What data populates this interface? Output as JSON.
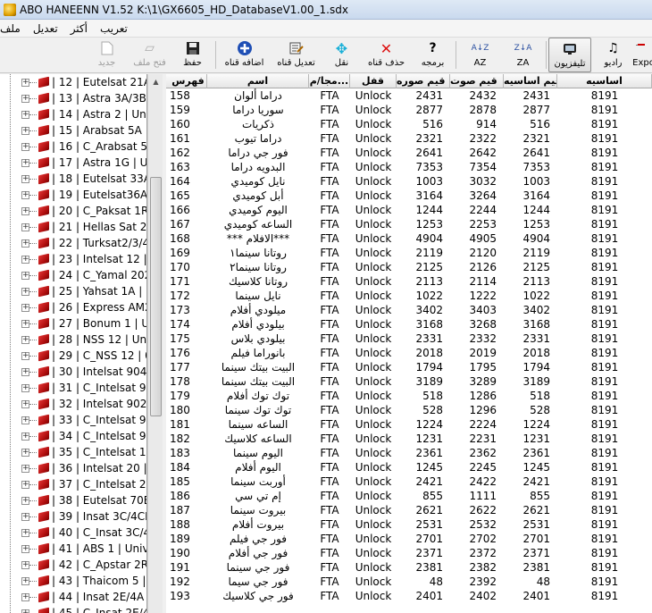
{
  "window": {
    "title": "ABO HANEENN     V1.52 K:\\1\\GX6605_HD_DatabaseV1.00_1.sdx"
  },
  "menu": [
    "تعريب",
    "أكثر",
    "تعديل",
    "ملف"
  ],
  "toolbar": [
    {
      "label": "Expo",
      "icon": "export-icon",
      "disabled": false,
      "selected": false
    },
    {
      "label": "راديو",
      "icon": "music-note-icon",
      "disabled": false,
      "selected": false
    },
    {
      "label": "تليفزيون",
      "icon": "tv-icon",
      "disabled": false,
      "selected": true
    },
    {
      "label": "ZA",
      "icon": "sort-za-icon",
      "disabled": false,
      "selected": false
    },
    {
      "label": "AZ",
      "icon": "sort-az-icon",
      "disabled": false,
      "selected": false
    },
    {
      "label": "برمجه",
      "icon": "help-icon",
      "disabled": false,
      "selected": false
    },
    {
      "label": "حذف قناه",
      "icon": "delete-icon",
      "disabled": false,
      "selected": false
    },
    {
      "label": "نقل",
      "icon": "move-icon",
      "disabled": false,
      "selected": false
    },
    {
      "label": "تعديل قناه",
      "icon": "edit-icon",
      "disabled": false,
      "selected": false
    },
    {
      "label": "اضافه قناه",
      "icon": "add-icon",
      "disabled": false,
      "selected": false
    },
    {
      "label": "حفظ",
      "icon": "save-icon",
      "disabled": false,
      "selected": false
    },
    {
      "label": "فتح ملف",
      "icon": "open-folder-icon",
      "disabled": true,
      "selected": false
    },
    {
      "label": "جديد",
      "icon": "new-file-icon",
      "disabled": true,
      "selected": false
    }
  ],
  "satellites": [
    "| 12 | Eutelsat 21A  |",
    "| 13 | Astra 3A/3B | U",
    "| 14 | Astra 2 | Univer",
    "| 15 | Arabsat 5A  | U",
    "| 16 | C_Arabsat 5A",
    "| 17 | Astra 1G  | Univ",
    "| 18 | Eutelsat 33A  |",
    "| 19 | Eutelsat36A/B",
    "| 20 | C_Paksat 1R  | (",
    "| 21 | Hellas Sat 2  | U",
    "| 22 | Turksat2/3/4A",
    "| 23 | Intelsat 12  | Ur",
    "| 24 | C_Yamal 202  |",
    "| 25 | Yahsat 1A  | Ur",
    "| 26 | Express AM22",
    "| 27 | Bonum 1 | Univ",
    "| 28 | NSS 12  | Unive",
    "| 29 | C_NSS 12  | 051",
    "| 30 | Intelsat 904  | U",
    "| 31 | C_Intelsat 904",
    "| 32 | Intelsat 902  | U",
    "| 33 | C_Intelsat 902",
    "| 34 | C_Intelsat 906",
    "| 35 | C_Intelsat 17  |",
    "| 36 | Intelsat 20 | Ur",
    "| 37 | C_Intelsat 20 |",
    "| 38 | Eutelsat 70B  | (",
    "| 39 | Insat 3C/4CR |",
    "| 40 | C_Insat 3C/4CF",
    "| 41 | ABS 1 | Univer",
    "| 42 | C_Apstar 2R  | (",
    "| 43 | Thaicom 5  | U",
    "| 44 | Insat 2E/4A  | U",
    "| 45 | C_Insat 2E/4A |"
  ],
  "grid": {
    "headers": {
      "idx": "فهرس",
      "name": "اسم",
      "fta": "مجا/م...",
      "lock": "قفل",
      "vpid": "قيم صوره",
      "apid": "قيم صوت",
      "sid": "قيم اساسيه",
      "base": "اساسيه"
    },
    "rows": [
      [
        "158",
        "دراما ألوان",
        "FTA",
        "Unlock",
        "2431",
        "2432",
        "2431",
        "8191"
      ],
      [
        "159",
        "سوريا دراما",
        "FTA",
        "Unlock",
        "2877",
        "2878",
        "2877",
        "8191"
      ],
      [
        "160",
        "ذكريات",
        "FTA",
        "Unlock",
        "516",
        "914",
        "516",
        "8191"
      ],
      [
        "161",
        "دراما تيوب",
        "FTA",
        "Unlock",
        "2321",
        "2322",
        "2321",
        "8191"
      ],
      [
        "162",
        "فور جي دراما",
        "FTA",
        "Unlock",
        "2641",
        "2642",
        "2641",
        "8191"
      ],
      [
        "163",
        "البدويه دراما",
        "FTA",
        "Unlock",
        "7353",
        "7354",
        "7353",
        "8191"
      ],
      [
        "164",
        "نايل كوميدي",
        "FTA",
        "Unlock",
        "1003",
        "3032",
        "1003",
        "8191"
      ],
      [
        "165",
        "أبل كوميدي",
        "FTA",
        "Unlock",
        "3164",
        "3264",
        "3164",
        "8191"
      ],
      [
        "166",
        "اليوم كوميدي",
        "FTA",
        "Unlock",
        "1244",
        "2244",
        "1244",
        "8191"
      ],
      [
        "167",
        "الساعه كوميدي",
        "FTA",
        "Unlock",
        "1253",
        "2253",
        "1253",
        "8191"
      ],
      [
        "168",
        "***الافلام ***",
        "FTA",
        "Unlock",
        "4904",
        "4905",
        "4904",
        "8191"
      ],
      [
        "169",
        "روتانا سينما١",
        "FTA",
        "Unlock",
        "2119",
        "2120",
        "2119",
        "8191"
      ],
      [
        "170",
        "روتانا سينما٢",
        "FTA",
        "Unlock",
        "2125",
        "2126",
        "2125",
        "8191"
      ],
      [
        "171",
        "روتانا كلاسيك",
        "FTA",
        "Unlock",
        "2113",
        "2114",
        "2113",
        "8191"
      ],
      [
        "172",
        "نايل سينما",
        "FTA",
        "Unlock",
        "1022",
        "1222",
        "1022",
        "8191"
      ],
      [
        "173",
        "ميلودي أفلام",
        "FTA",
        "Unlock",
        "3402",
        "3403",
        "3402",
        "8191"
      ],
      [
        "174",
        "بيلودي أفلام",
        "FTA",
        "Unlock",
        "3168",
        "3268",
        "3168",
        "8191"
      ],
      [
        "175",
        "بيلودي بلاس",
        "FTA",
        "Unlock",
        "2331",
        "2332",
        "2331",
        "8191"
      ],
      [
        "176",
        "بانوراما فيلم",
        "FTA",
        "Unlock",
        "2018",
        "2019",
        "2018",
        "8191"
      ],
      [
        "177",
        "البيت بيتك سينما",
        "FTA",
        "Unlock",
        "1794",
        "1795",
        "1794",
        "8191"
      ],
      [
        "178",
        "البيت بيتك سينما",
        "FTA",
        "Unlock",
        "3189",
        "3289",
        "3189",
        "8191"
      ],
      [
        "179",
        "توك توك أفلام",
        "FTA",
        "Unlock",
        "518",
        "1286",
        "518",
        "8191"
      ],
      [
        "180",
        "توك توك سينما",
        "FTA",
        "Unlock",
        "528",
        "1296",
        "528",
        "8191"
      ],
      [
        "181",
        "الساعه سينما",
        "FTA",
        "Unlock",
        "1224",
        "2224",
        "1224",
        "8191"
      ],
      [
        "182",
        "الساعه كلاسيك",
        "FTA",
        "Unlock",
        "1231",
        "2231",
        "1231",
        "8191"
      ],
      [
        "183",
        "اليوم سينما",
        "FTA",
        "Unlock",
        "2361",
        "2362",
        "2361",
        "8191"
      ],
      [
        "184",
        "اليوم أفلام",
        "FTA",
        "Unlock",
        "1245",
        "2245",
        "1245",
        "8191"
      ],
      [
        "185",
        "أوربت سينما",
        "FTA",
        "Unlock",
        "2421",
        "2422",
        "2421",
        "8191"
      ],
      [
        "186",
        "إم تي سي",
        "FTA",
        "Unlock",
        "855",
        "1111",
        "855",
        "8191"
      ],
      [
        "187",
        "بيروت سينما",
        "FTA",
        "Unlock",
        "2621",
        "2622",
        "2621",
        "8191"
      ],
      [
        "188",
        "بيروت أفلام",
        "FTA",
        "Unlock",
        "2531",
        "2532",
        "2531",
        "8191"
      ],
      [
        "189",
        "فور جي فيلم",
        "FTA",
        "Unlock",
        "2701",
        "2702",
        "2701",
        "8191"
      ],
      [
        "190",
        "فور جي أفلام",
        "FTA",
        "Unlock",
        "2371",
        "2372",
        "2371",
        "8191"
      ],
      [
        "191",
        "فور جي سينما",
        "FTA",
        "Unlock",
        "2381",
        "2382",
        "2381",
        "8191"
      ],
      [
        "192",
        "فور جي سيما",
        "FTA",
        "Unlock",
        "48",
        "2392",
        "48",
        "8191"
      ],
      [
        "193",
        "فور جي كلاسيك",
        "FTA",
        "Unlock",
        "2401",
        "2402",
        "2401",
        "8191"
      ]
    ]
  }
}
